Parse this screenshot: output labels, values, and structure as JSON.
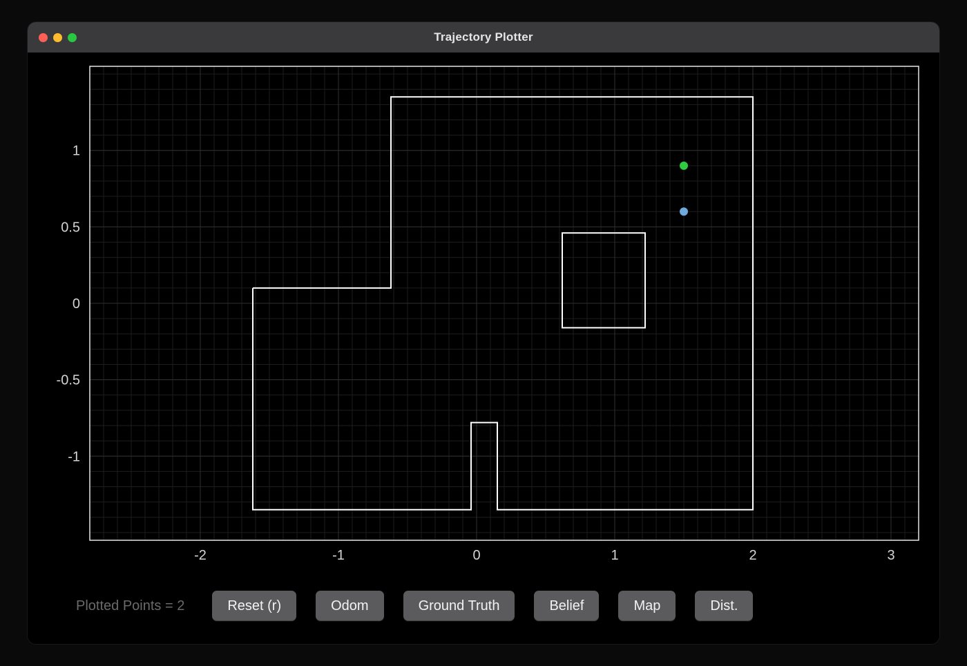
{
  "window": {
    "title": "Trajectory Plotter"
  },
  "status": {
    "text": "Plotted Points = 2"
  },
  "buttons": {
    "reset": "Reset (r)",
    "odom": "Odom",
    "gt": "Ground Truth",
    "belief": "Belief",
    "map": "Map",
    "dist": "Dist."
  },
  "chart_data": {
    "type": "scatter",
    "title": "",
    "xlabel": "",
    "ylabel": "",
    "xlim": [
      -2.8,
      3.2
    ],
    "ylim": [
      -1.55,
      1.55
    ],
    "x_ticks": [
      -2,
      -1,
      0,
      1,
      2,
      3
    ],
    "y_ticks": [
      -1,
      -0.5,
      0,
      0.5,
      1
    ],
    "grid": {
      "major": true,
      "minor": true
    },
    "series": [
      {
        "name": "green",
        "color": "#2ecc40",
        "points": [
          {
            "x": 1.5,
            "y": 0.9
          }
        ]
      },
      {
        "name": "blue",
        "color": "#6fa8dc",
        "points": [
          {
            "x": 1.5,
            "y": 0.6
          }
        ]
      }
    ],
    "map_outline": [
      [
        -1.62,
        0.1
      ],
      [
        -0.62,
        0.1
      ],
      [
        -0.62,
        1.35
      ],
      [
        2.0,
        1.35
      ],
      [
        2.0,
        -1.35
      ],
      [
        0.15,
        -1.35
      ],
      [
        0.15,
        -0.78
      ],
      [
        -0.04,
        -0.78
      ],
      [
        -0.04,
        -1.35
      ],
      [
        -1.62,
        -1.35
      ],
      [
        -1.62,
        0.1
      ]
    ],
    "obstacles": [
      {
        "x0": 0.62,
        "y0": -0.16,
        "x1": 1.22,
        "y1": 0.46
      }
    ],
    "colors": {
      "grid_minor": "#1e1e1e",
      "grid_major": "#2f2f2f",
      "axis": "#e6e6e6",
      "map_line": "#ffffff",
      "tick_text": "#d4d4d4"
    }
  }
}
